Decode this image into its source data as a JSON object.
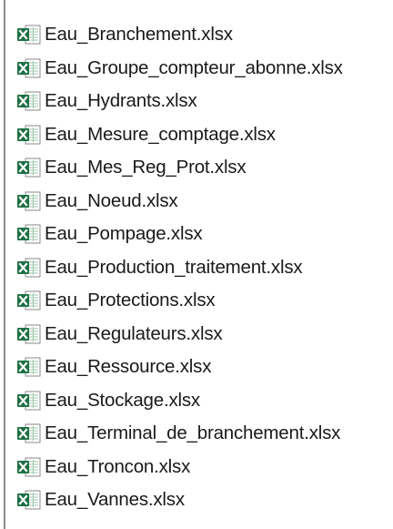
{
  "file_list": {
    "icon": "excel-xlsx-icon",
    "colors": {
      "icon_green": "#1d7044",
      "icon_doc_border": "#8a8a8a",
      "text": "#1a1a1a",
      "border": "#8c8c8c"
    },
    "items": [
      {
        "name": "Eau_Branchement.xlsx"
      },
      {
        "name": "Eau_Groupe_compteur_abonne.xlsx"
      },
      {
        "name": "Eau_Hydrants.xlsx"
      },
      {
        "name": "Eau_Mesure_comptage.xlsx"
      },
      {
        "name": "Eau_Mes_Reg_Prot.xlsx"
      },
      {
        "name": "Eau_Noeud.xlsx"
      },
      {
        "name": "Eau_Pompage.xlsx"
      },
      {
        "name": "Eau_Production_traitement.xlsx"
      },
      {
        "name": "Eau_Protections.xlsx"
      },
      {
        "name": "Eau_Regulateurs.xlsx"
      },
      {
        "name": "Eau_Ressource.xlsx"
      },
      {
        "name": "Eau_Stockage.xlsx"
      },
      {
        "name": "Eau_Terminal_de_branchement.xlsx"
      },
      {
        "name": "Eau_Troncon.xlsx"
      },
      {
        "name": "Eau_Vannes.xlsx"
      }
    ]
  }
}
